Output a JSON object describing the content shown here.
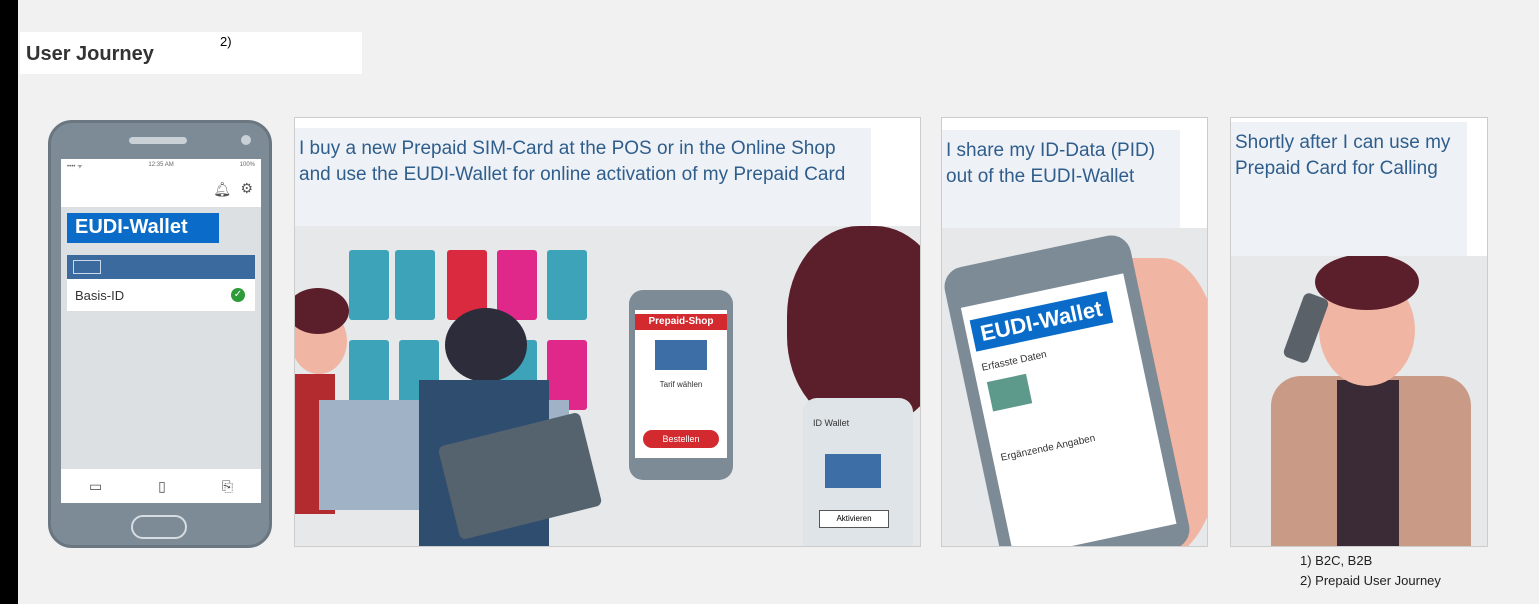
{
  "header": {
    "title": "User Journey",
    "ref": "2)"
  },
  "phone": {
    "app_title": "EUDI-Wallet",
    "item_label": "Basis-ID",
    "status_time": "12:35 AM",
    "status_battery": "100%"
  },
  "panels": [
    {
      "caption": "I buy a new Prepaid SIM-Card at the POS or in the Online Shop and use the EUDI-Wallet for online activation of my Prepaid Card"
    },
    {
      "caption": "I share my ID-Data (PID) out of the EUDI-Wallet"
    },
    {
      "caption": "Shortly after I can use my Prepaid Card for Calling"
    }
  ],
  "illustration": {
    "shop_header": "Prepaid-Shop",
    "tarif": "Tarif wählen",
    "bestellen": "Bestellen",
    "id_wallet": "ID Wallet",
    "aktivieren": "Aktivieren",
    "wallet2_title": "EUDI-Wallet",
    "erfasste": "Erfasste Daten",
    "ergaenzende": "Ergänzende Angaben"
  },
  "footnotes": [
    "1)  B2C, B2B",
    "2)  Prepaid User Journey"
  ],
  "colors": {
    "wallet_blue": "#0a6cc8",
    "caption_text": "#2f5d8c",
    "check_green": "#2e9b3a"
  }
}
